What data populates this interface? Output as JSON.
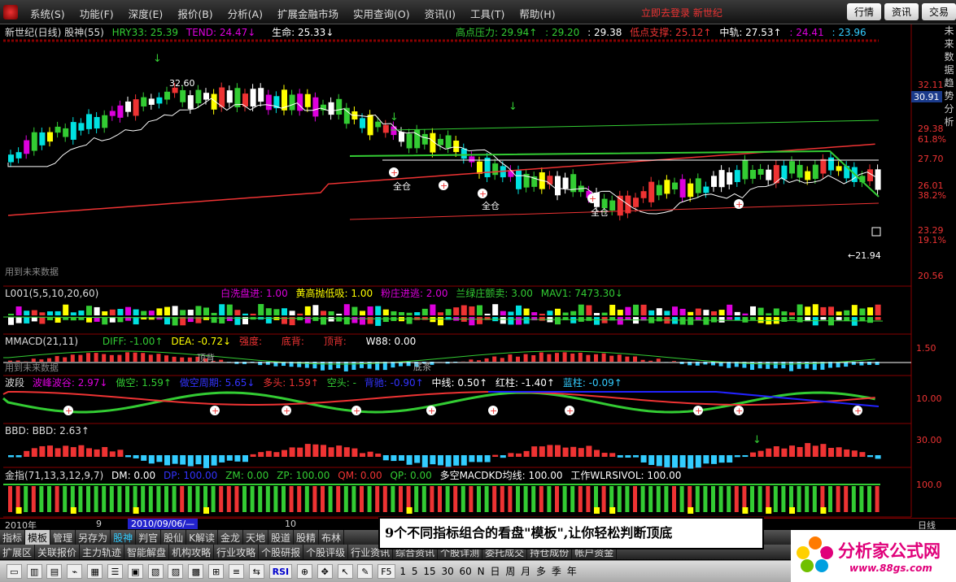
{
  "menubar": {
    "items": [
      "系统(S)",
      "功能(F)",
      "深度(E)",
      "报价(B)",
      "分析(A)",
      "扩展金融市场",
      "实用查询(O)",
      "资讯(I)",
      "工具(T)",
      "帮助(H)"
    ],
    "center": "立即去登录  新世纪",
    "tabs": [
      "行情",
      "资讯",
      "交易"
    ]
  },
  "main_panel": {
    "title": "新世纪(日线) 股神(55)",
    "hry": "HRY33: 25.39",
    "tend": "TEND: 24.47↓",
    "life": "生命: 25.33↓",
    "high_pressure": "高点压力: 29.94↑",
    "v1": ": 29.20",
    "v2": ": 29.38",
    "low_support": "低点支撑: 25.12↑",
    "mid": "中轨: 27.53↑",
    "v3": ": 24.41",
    "v4": ": 23.96",
    "future_note": "用到未来数据",
    "peak": "32.60",
    "trough": "←21.94",
    "full_pos": "全仓",
    "price_box": "30.91",
    "ticks": [
      "32.11",
      "29.38",
      "61.8%",
      "27.70",
      "26.01",
      "38.2%",
      "23.29",
      "19.1%",
      "20.56"
    ]
  },
  "l001": {
    "title": "L001(5,5,10,20,60)",
    "i1": "白洗盘进: 1.00",
    "i2": "黄高抛低吸: 1.00",
    "i3": "粉庄进逃: 2.00",
    "i4": "兰绿庄颤卖: 3.00",
    "i5": "MAV1: 7473.30↓"
  },
  "mmacd": {
    "title": "MMACD(21,11)",
    "diff": "DIFF: -1.00↑",
    "dea": "DEA: -0.72↓",
    "s1": "强度:",
    "s2": "底背:",
    "s3": "顶背:",
    "w88": "W88: 0.00",
    "future_note": "用到未来数据",
    "tick": "1.50",
    "label_top": "顶背",
    "label_bottom": "底茶"
  },
  "wave": {
    "title": "波段",
    "w1": "波峰波谷: 2.97↓",
    "w2": "做空: 1.59↑",
    "w3": "做空周期: 5.65↓",
    "w4": "多头: 1.59↑",
    "w5": "空头: -",
    "w6": "背驰: -0.90↑",
    "w7": "中线: 0.50↑",
    "w8": "红柱: -1.40↑",
    "w9": "蓝柱: -0.09↑",
    "tick": "10.00"
  },
  "bbd": {
    "title": "BBD: BBD: 2.63↑",
    "tick": "30.00"
  },
  "jinzhi": {
    "title": "金指(71,13,3,12,9,7)",
    "dm": "DM: 0.00",
    "dp": "DP: 100.00",
    "zm": "ZM: 0.00",
    "zp": "ZP: 100.00",
    "qm": "QM: 0.00",
    "qp": "QP: 0.00",
    "duo": "多空MACDKD均线: 100.00",
    "work": "工作WLRSIVOL: 100.00",
    "tick": "100.0"
  },
  "timebar": {
    "year": "2010年",
    "month": "9",
    "date": "2010/09/06/—",
    "m10": "10",
    "daily": "日线"
  },
  "tabs1": [
    "指标",
    "模板",
    "管理",
    "另存为",
    "股神",
    "判官",
    "股仙",
    "K解读",
    "金龙",
    "天地",
    "股道",
    "股精",
    "布林"
  ],
  "tabs2": [
    "扩展区",
    "关联报价",
    "主力轨迹",
    "智能解盘",
    "机构攻略",
    "行业攻略",
    "个股研报",
    "个股评级",
    "行业资讯",
    "综合资讯",
    "个股详测",
    "委托成交",
    "持仓成份",
    "帐户资金"
  ],
  "toolbar": {
    "texts": [
      "RSI",
      "F5",
      "1",
      "5",
      "15",
      "30",
      "60",
      "N",
      "日",
      "周",
      "月",
      "多",
      "季",
      "年"
    ]
  },
  "banner": "9个不同指标组合的看盘\"模板\",让你轻松判断顶底",
  "logo": {
    "title": "分析家公式网",
    "url": "www.88gs.com"
  },
  "right_edge": "未来数据趋势分析"
}
